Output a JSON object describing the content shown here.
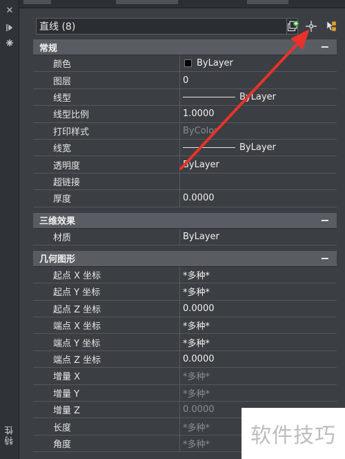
{
  "sidebar": {
    "close_icon": "close-icon",
    "pin_icon": "auto-hide-icon",
    "settings_icon": "properties-icon",
    "title": "特性"
  },
  "toolbar": {
    "selection_label": "直线 (8)",
    "buttons": [
      "toggle-pickadd-icon",
      "select-objects-icon",
      "quick-select-icon"
    ]
  },
  "sections": [
    {
      "title": "常规",
      "rows": [
        {
          "name": "颜色",
          "value": "ByLayer",
          "kind": "color"
        },
        {
          "name": "图层",
          "value": "0"
        },
        {
          "name": "线型",
          "value": "ByLayer",
          "kind": "line"
        },
        {
          "name": "线型比例",
          "value": "1.0000"
        },
        {
          "name": "打印样式",
          "value": "ByColor",
          "dim": true
        },
        {
          "name": "线宽",
          "value": "ByLayer",
          "kind": "line"
        },
        {
          "name": "透明度",
          "value": "ByLayer"
        },
        {
          "name": "超链接",
          "value": ""
        },
        {
          "name": "厚度",
          "value": "0.0000"
        }
      ]
    },
    {
      "title": "三维效果",
      "rows": [
        {
          "name": "材质",
          "value": "ByLayer"
        }
      ]
    },
    {
      "title": "几何图形",
      "rows": [
        {
          "name": "起点 X 坐标",
          "value": "*多种*"
        },
        {
          "name": "起点 Y 坐标",
          "value": "*多种*"
        },
        {
          "name": "起点 Z 坐标",
          "value": "0.0000"
        },
        {
          "name": "端点 X 坐标",
          "value": "*多种*"
        },
        {
          "name": "端点 Y 坐标",
          "value": "*多种*"
        },
        {
          "name": "端点 Z 坐标",
          "value": "0.0000"
        },
        {
          "name": "增量 X",
          "value": "*多种*",
          "dim": true
        },
        {
          "name": "增量 Y",
          "value": "*多种*",
          "dim": true
        },
        {
          "name": "增量 Z",
          "value": "0.0000",
          "dim": true
        },
        {
          "name": "长度",
          "value": "*多种*",
          "dim": true
        },
        {
          "name": "角度",
          "value": "*多种*",
          "dim": true
        }
      ]
    }
  ],
  "section_toggle": "−",
  "watermark": "软件技巧",
  "colors": {
    "panel_bg": "#3b3e43",
    "header_bg": "#595d63",
    "annotation_arrow": "#e8332a",
    "dim_text": "#8a8e94"
  }
}
